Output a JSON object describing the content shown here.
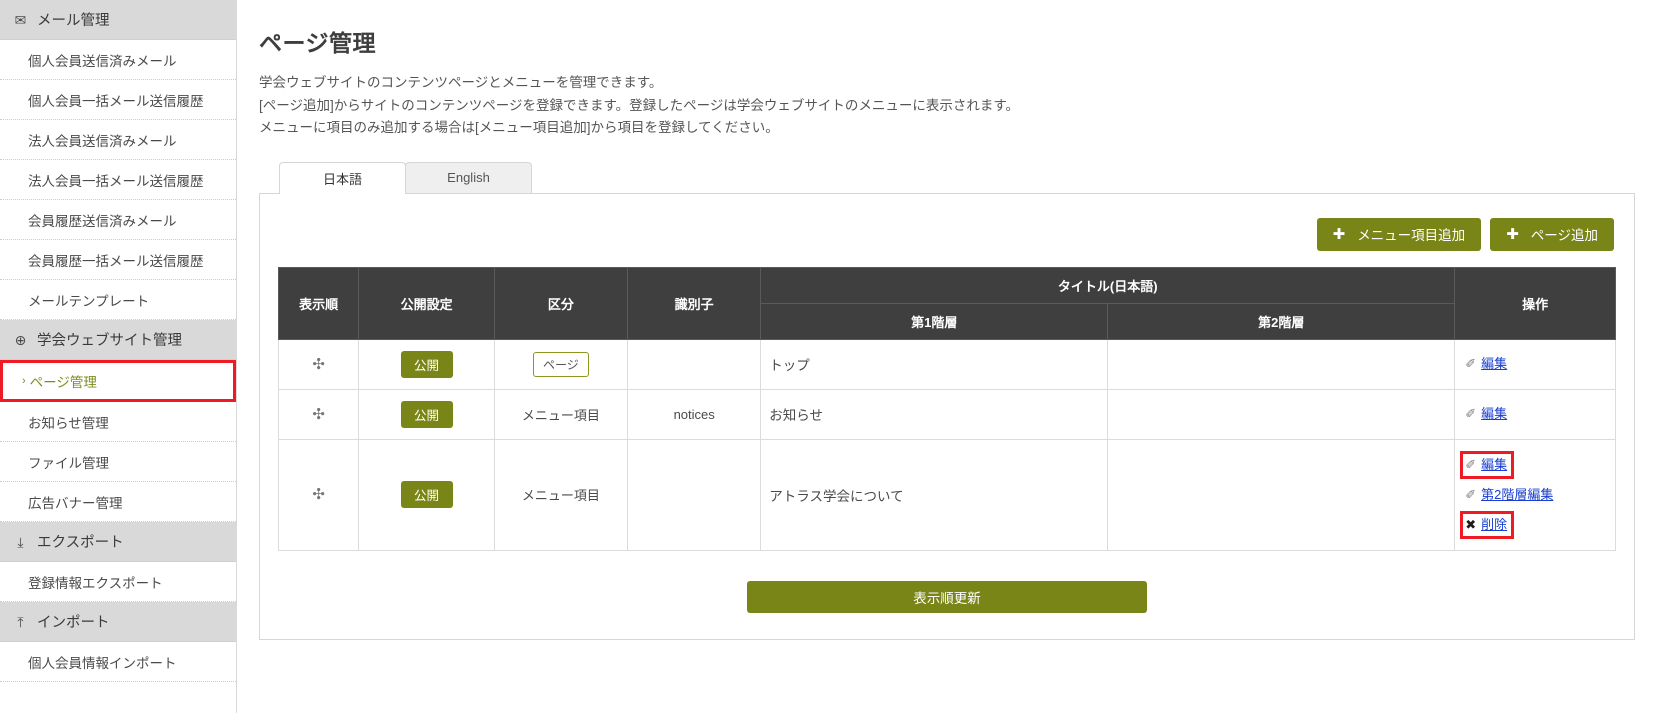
{
  "sidebar": {
    "groups": [
      {
        "label": "メール管理",
        "icon": "mail-icon",
        "glyph": "✉",
        "items": [
          {
            "label": "個人会員送信済みメール",
            "selected": false
          },
          {
            "label": "個人会員一括メール送信履歴",
            "selected": false
          },
          {
            "label": "法人会員送信済みメール",
            "selected": false
          },
          {
            "label": "法人会員一括メール送信履歴",
            "selected": false
          },
          {
            "label": "会員履歴送信済みメール",
            "selected": false
          },
          {
            "label": "会員履歴一括メール送信履歴",
            "selected": false
          },
          {
            "label": "メールテンプレート",
            "selected": false
          }
        ]
      },
      {
        "label": "学会ウェブサイト管理",
        "icon": "globe-icon",
        "glyph": "⊕",
        "items": [
          {
            "label": "ページ管理",
            "selected": true,
            "chevron": "›"
          },
          {
            "label": "お知らせ管理",
            "selected": false
          },
          {
            "label": "ファイル管理",
            "selected": false
          },
          {
            "label": "広告バナー管理",
            "selected": false
          }
        ]
      },
      {
        "label": "エクスポート",
        "icon": "download-icon",
        "glyph": "⤓",
        "items": [
          {
            "label": "登録情報エクスポート",
            "selected": false
          }
        ]
      },
      {
        "label": "インポート",
        "icon": "upload-icon",
        "glyph": "⤒",
        "items": [
          {
            "label": "個人会員情報インポート",
            "selected": false
          }
        ]
      }
    ],
    "selected_highlight_color": "#ee1b24",
    "selected_text_color": "#7d8c1f"
  },
  "main": {
    "page_title": "ページ管理",
    "description": [
      "学会ウェブサイトのコンテンツページとメニューを管理できます。",
      "[ページ追加]からサイトのコンテンツページを登録できます。登録したページは学会ウェブサイトのメニューに表示されます。",
      "メニューに項目のみ追加する場合は[メニュー項目追加]から項目を登録してください。"
    ],
    "tabs": [
      {
        "label": "日本語",
        "active": true
      },
      {
        "label": "English",
        "active": false
      }
    ],
    "toolbar": {
      "add_menu_item_label": "メニュー項目追加",
      "add_page_label": "ページ追加",
      "plus_glyph": "✚",
      "button_color": "#7a8518"
    },
    "table": {
      "columns": {
        "order": "表示順",
        "publish": "公開設定",
        "kind": "区分",
        "identifier": "識別子",
        "title_group": "タイトル(日本語)",
        "level1": "第1階層",
        "level2": "第2階層",
        "operations": "操作"
      },
      "header_bg": "#3f3f3f",
      "rows": [
        {
          "move_glyph": "✣",
          "publish": "公開",
          "kind": "ページ",
          "kind_style": "outline",
          "identifier": "",
          "level1": "トップ",
          "level2": "",
          "operations": [
            {
              "label": "編集",
              "icon": "pencil-icon",
              "glyph": "✐",
              "highlighted": false
            }
          ]
        },
        {
          "move_glyph": "✣",
          "publish": "公開",
          "kind": "メニュー項目",
          "kind_style": "plain",
          "identifier": "notices",
          "level1": "お知らせ",
          "level2": "",
          "operations": [
            {
              "label": "編集",
              "icon": "pencil-icon",
              "glyph": "✐",
              "highlighted": false
            }
          ]
        },
        {
          "move_glyph": "✣",
          "publish": "公開",
          "kind": "メニュー項目",
          "kind_style": "plain",
          "identifier": "",
          "level1": "アトラス学会について",
          "level2": "",
          "operations": [
            {
              "label": "編集",
              "icon": "pencil-icon",
              "glyph": "✐",
              "highlighted": true
            },
            {
              "label": "第2階層編集",
              "icon": "pencil-icon",
              "glyph": "✐",
              "highlighted": false
            },
            {
              "label": "削除",
              "icon": "close-icon",
              "glyph": "✖",
              "highlighted": true
            }
          ]
        }
      ]
    },
    "update_order_button": "表示順更新"
  }
}
